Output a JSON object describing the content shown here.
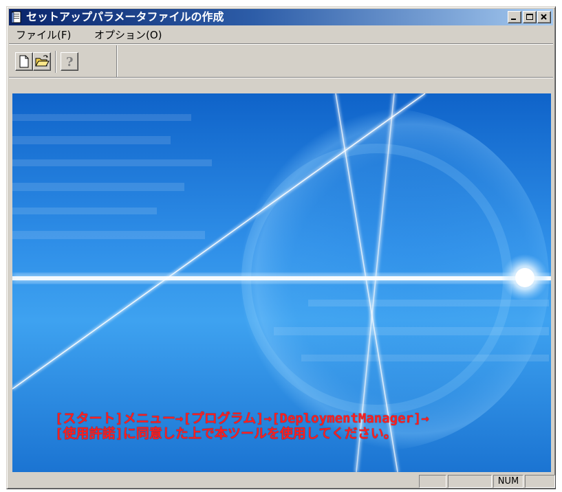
{
  "window": {
    "title": "セットアップパラメータファイルの作成",
    "controls": {
      "minimize": "minimize",
      "maximize": "maximize",
      "close": "close"
    }
  },
  "menu": {
    "items": [
      {
        "label": "ファイル(F)"
      },
      {
        "label": "オプション(O)"
      }
    ]
  },
  "toolbar": {
    "buttons": [
      {
        "name": "new",
        "icon": "new-document-icon"
      },
      {
        "name": "open",
        "icon": "open-folder-icon"
      },
      {
        "name": "help",
        "icon": "help-question-icon"
      }
    ]
  },
  "content": {
    "notice_line1": "[スタート]メニュー→[プログラム]→[DeploymentManager]→",
    "notice_line2": "[使用許諾]に同意した上で本ツールを使用してください。",
    "notice_color": "#ff1f1f"
  },
  "statusbar": {
    "main": "",
    "pane1": "",
    "pane2": "",
    "pane3": "NUM",
    "pane4": ""
  }
}
